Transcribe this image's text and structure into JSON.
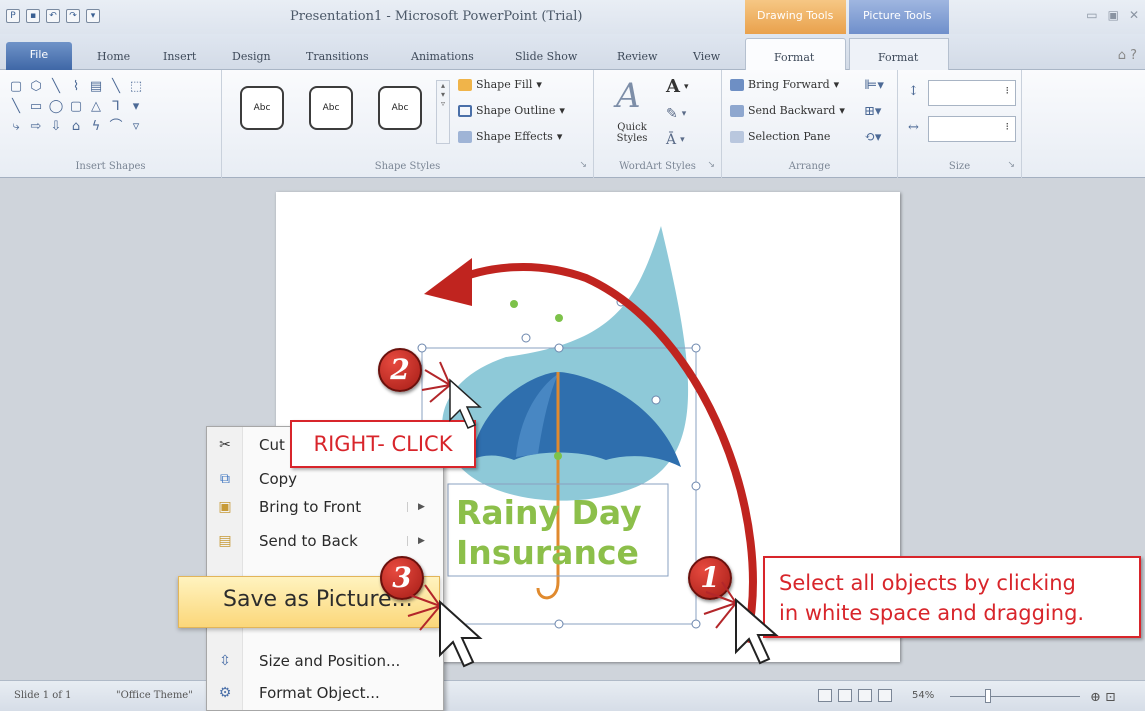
{
  "window": {
    "title": "Presentation1 - Microsoft PowerPoint (Trial)",
    "contextual": {
      "drawing_tools": "Drawing Tools",
      "picture_tools": "Picture Tools"
    }
  },
  "tabs": [
    "File",
    "Home",
    "Insert",
    "Design",
    "Transitions",
    "Animations",
    "Slide Show",
    "Review",
    "View",
    "Format",
    "Format"
  ],
  "ribbon": {
    "insert_shapes": {
      "label": "Insert Shapes"
    },
    "shape_styles": {
      "label": "Shape Styles",
      "gallery": [
        "Abc",
        "Abc",
        "Abc"
      ],
      "commands": [
        "Shape Fill",
        "Shape Outline",
        "Shape Effects"
      ]
    },
    "wordart_styles": {
      "label": "WordArt Styles",
      "quick_styles": "Quick Styles"
    },
    "arrange": {
      "label": "Arrange",
      "commands": [
        "Bring Forward",
        "Send Backward",
        "Selection Pane"
      ]
    },
    "size": {
      "label": "Size"
    }
  },
  "slide": {
    "title_line1": "Rainy Day",
    "title_line2": "Insurance",
    "colors": {
      "drop": "#8ec9d8",
      "umbrella": "#2f6fae",
      "text": "#8cbf4a",
      "arrow": "#c0241f"
    }
  },
  "context_menu": {
    "items": [
      {
        "icon": "scissors-icon",
        "label": "Cut"
      },
      {
        "icon": "copy-icon",
        "label": "Copy"
      },
      {
        "icon": "bring-to-front-icon",
        "label": "Bring to Front"
      },
      {
        "icon": "send-to-back-icon",
        "label": "Send to Back"
      },
      {
        "icon": "save-picture-icon",
        "label": "Save as Picture..."
      },
      {
        "icon": "size-position-icon",
        "label": "Size and Position..."
      },
      {
        "icon": "format-object-icon",
        "label": "Format Object..."
      }
    ]
  },
  "callouts": {
    "right_click": "RIGHT- CLICK",
    "select_line1": "Select all objects by clicking",
    "select_line2": "in white space and dragging.",
    "step1": "1",
    "step2": "2",
    "step3": "3"
  },
  "statusbar": {
    "slide": "Slide 1 of 1",
    "theme": "\"Office Theme\"",
    "zoom": "54%"
  }
}
